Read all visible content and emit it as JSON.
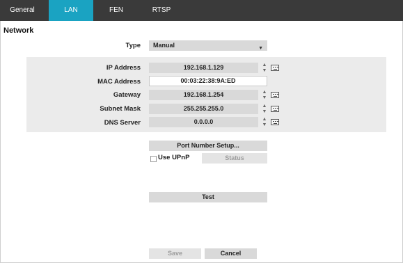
{
  "tabs": [
    {
      "label": "General"
    },
    {
      "label": "LAN"
    },
    {
      "label": "FEN"
    },
    {
      "label": "RTSP"
    }
  ],
  "section": {
    "title": "Network"
  },
  "type": {
    "label": "Type",
    "value": "Manual"
  },
  "fields": {
    "ip": {
      "label": "IP Address",
      "value": "192.168.1.129"
    },
    "mac": {
      "label": "MAC Address",
      "value": "00:03:22:38:9A:ED"
    },
    "gateway": {
      "label": "Gateway",
      "value": "192.168.1.254"
    },
    "subnet": {
      "label": "Subnet Mask",
      "value": "255.255.255.0"
    },
    "dns": {
      "label": "DNS Server",
      "value": "0.0.0.0"
    }
  },
  "buttons": {
    "port_setup": "Port Number Setup...",
    "status": "Status",
    "test": "Test",
    "save": "Save",
    "cancel": "Cancel"
  },
  "upnp": {
    "label": "Use UPnP",
    "checked": false
  },
  "colors": {
    "tab_active": "#1aa3c2",
    "tabbar": "#3a3a3a",
    "field": "#d9d9d9",
    "panel": "#ebebeb"
  },
  "icons": [
    "spinner-arrows-icon",
    "keyboard-icon",
    "dropdown-arrow-icon",
    "checkbox-icon"
  ]
}
